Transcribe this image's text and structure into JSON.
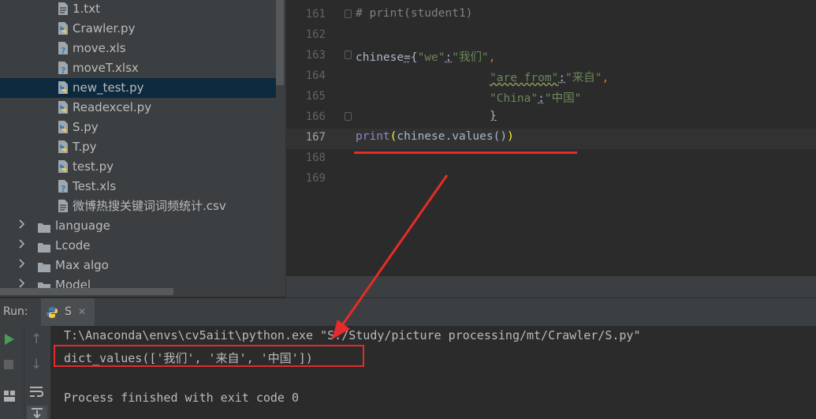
{
  "project_tree": {
    "files": [
      {
        "label": "1.txt",
        "type": "text"
      },
      {
        "label": "Crawler.py",
        "type": "python"
      },
      {
        "label": "move.xls",
        "type": "unknown"
      },
      {
        "label": "moveT.xlsx",
        "type": "unknown"
      },
      {
        "label": "new_test.py",
        "type": "python",
        "selected": true
      },
      {
        "label": "Readexcel.py",
        "type": "python"
      },
      {
        "label": "S.py",
        "type": "python"
      },
      {
        "label": "T.py",
        "type": "python"
      },
      {
        "label": "test.py",
        "type": "python"
      },
      {
        "label": "Test.xls",
        "type": "unknown"
      },
      {
        "label": "微博热搜关键词词频统计.csv",
        "type": "text"
      }
    ],
    "folders": [
      {
        "label": "language"
      },
      {
        "label": "Lcode"
      },
      {
        "label": "Max algo"
      },
      {
        "label": "Model"
      }
    ]
  },
  "editor": {
    "line_numbers": [
      "161",
      "162",
      "163",
      "164",
      "165",
      "166",
      "167",
      "168",
      "169"
    ],
    "current_line": "167",
    "code": {
      "l161": "# print(student1)",
      "l163_name": "chinese",
      "l163_eq": "=",
      "l163_open": "{",
      "l163_key": "\"we\"",
      "l163_colon": ":",
      "l163_val": "\"我们\"",
      "l163_comma": ",",
      "l164_key": "\"are from\"",
      "l164_colon": ":",
      "l164_val": "\"来自\"",
      "l164_comma": ",",
      "l165_key": "\"China\"",
      "l165_colon": ":",
      "l165_val": "\"中国\"",
      "l166_close": "}",
      "l167_func": "print",
      "l167_open": "(",
      "l167_arg": "chinese.values()",
      "l167_close": ")"
    }
  },
  "run_panel": {
    "label": "Run:",
    "tab_label": "S",
    "close_glyph": "✕",
    "console": {
      "command": "T:\\Anaconda\\envs\\cv5aiit\\python.exe \"S:/Study/picture processing/mt/Crawler/S.py\"",
      "output": "dict_values(['我们', '来自', '中国'])",
      "exit_message": "Process finished with exit code 0"
    },
    "toolbar_glyphs": {
      "up": "↑",
      "down": "↓"
    }
  },
  "colors": {
    "keyword": "#cc7832",
    "string": "#6a8759",
    "comment": "#808080",
    "builtin": "#8888c6",
    "default_text": "#a9b7c6",
    "paren_match": "#ffef28",
    "annotation_red": "#e52b2b"
  }
}
